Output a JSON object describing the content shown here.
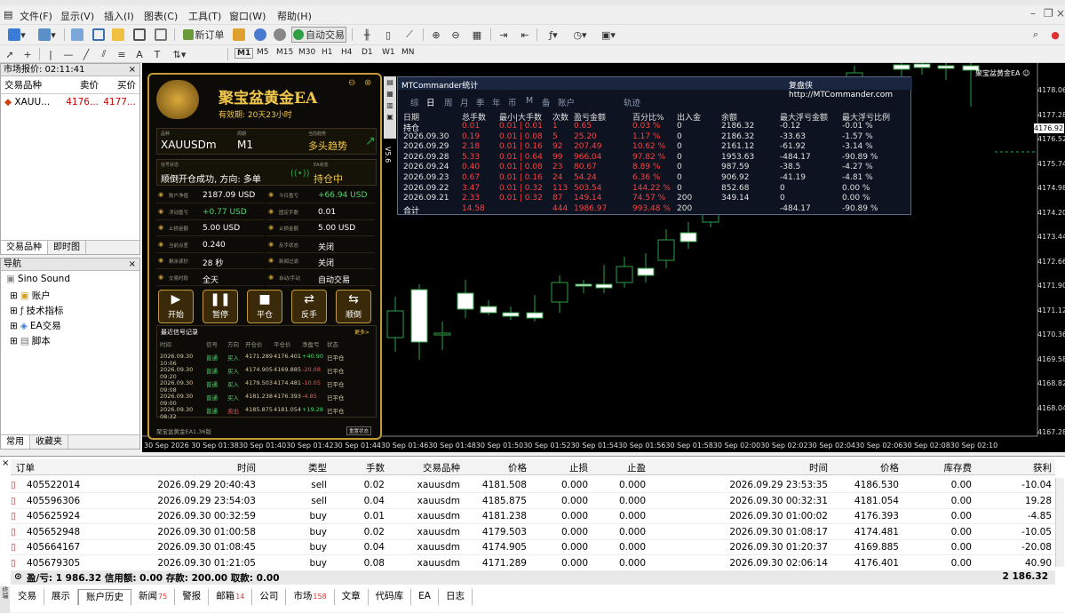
{
  "menu": [
    "文件(F)",
    "显示(V)",
    "插入(I)",
    "图表(C)",
    "工具(T)",
    "窗口(W)",
    "帮助(H)"
  ],
  "toolbar": {
    "new_order": "新订单",
    "auto_trade": "自动交易"
  },
  "timeframes": [
    "M1",
    "M5",
    "M15",
    "M30",
    "H1",
    "H4",
    "D1",
    "W1",
    "MN"
  ],
  "market_watch": {
    "title": "市场报价: 02:11:41",
    "headers": [
      "交易品种",
      "卖价",
      "买价"
    ],
    "row": {
      "symbol": "XAUU...",
      "bid": "4176...",
      "ask": "4177..."
    },
    "tabs": [
      "交易品种",
      "即时图"
    ]
  },
  "navigator": {
    "title": "导航",
    "items": [
      "Sino Sound",
      "账户",
      "技术指标",
      "EA交易",
      "脚本"
    ],
    "tabs": [
      "常用",
      "收藏夹"
    ]
  },
  "chart": {
    "ea_label": "聚宝盆黄金EA ☺",
    "current_price": "4176.923",
    "price_ticks": [
      "4178.060",
      "4177.280",
      "4176.520",
      "4175.740",
      "4174.980",
      "4174.200",
      "4173.440",
      "4172.660",
      "4171.900",
      "4171.120",
      "4170.360",
      "4169.580",
      "4168.820",
      "4168.040",
      "4167.280"
    ],
    "time_ticks": [
      "30 Sep 2026",
      "30 Sep 01:38",
      "30 Sep 01:40",
      "30 Sep 01:42",
      "30 Sep 01:44",
      "30 Sep 01:46",
      "30 Sep 01:48",
      "30 Sep 01:50",
      "30 Sep 01:52",
      "30 Sep 01:54",
      "30 Sep 01:56",
      "30 Sep 01:58",
      "30 Sep 02:00",
      "30 Sep 02:02",
      "30 Sep 02:04",
      "30 Sep 02:06",
      "30 Sep 02:08",
      "30 Sep 02:10"
    ],
    "side_label": "V5.6"
  },
  "ea_panel": {
    "title": "聚宝盆黄金EA",
    "validity": "有效期: 20天23小时",
    "symbol_label": "品种",
    "symbol": "XAUUSDm",
    "period_label": "周期",
    "period": "M1",
    "trend_label": "当前趋势",
    "trend": "多头趋势",
    "signal_label": "信号状态",
    "signal": "顺倒开仓成功, 方向: 多单",
    "ea_status_label": "EA状态",
    "ea_status": "持仓中",
    "stats": [
      {
        "label": "账户净值",
        "value": "2187.09 USD"
      },
      {
        "label": "今日盈亏",
        "value": "+66.94 USD"
      },
      {
        "label": "浮动盈亏",
        "value": "+0.77 USD"
      },
      {
        "label": "固定手数",
        "value": "0.01"
      },
      {
        "label": "止损金额",
        "value": "5.00 USD"
      },
      {
        "label": "止损金额",
        "value": "5.00 USD"
      },
      {
        "label": "当前点差",
        "value": "0.240"
      },
      {
        "label": "反手状态",
        "value": "关闭"
      },
      {
        "label": "剩余读秒",
        "value": "28 秒"
      },
      {
        "label": "新闻过滤",
        "value": "关闭"
      },
      {
        "label": "交易时段",
        "value": "全天"
      },
      {
        "label": "自动/手动",
        "value": "自动交易"
      }
    ],
    "buttons": [
      {
        "label": "开始",
        "sym": "▶"
      },
      {
        "label": "暂停",
        "sym": "❚❚"
      },
      {
        "label": "平仓",
        "sym": "■"
      },
      {
        "label": "反手",
        "sym": "⇄"
      },
      {
        "label": "顺倒",
        "sym": "⇆"
      }
    ],
    "signal_title": "最近信号记录",
    "more": "更多>",
    "signal_headers": [
      "时间",
      "信号",
      "方向",
      "开仓价",
      "平仓价",
      "净盈亏",
      "状态"
    ],
    "signals": [
      [
        "2026.09.30 10:06",
        "普通",
        "买入",
        "4171.289",
        "4176.401",
        "+40.90",
        "已平仓"
      ],
      [
        "2026.09.30 09:20",
        "普通",
        "买入",
        "4174.905",
        "4169.885",
        "-20.08",
        "已平仓"
      ],
      [
        "2026.09.30 09:08",
        "普通",
        "买入",
        "4179.503",
        "4174.481",
        "-10.05",
        "已平仓"
      ],
      [
        "2026.09.30 09:00",
        "普通",
        "买入",
        "4181.238",
        "4176.393",
        "-4.85",
        "已平仓"
      ],
      [
        "2026.09.30 08:32",
        "普通",
        "卖出",
        "4185.875",
        "4181.054",
        "+19.28",
        "已平仓"
      ]
    ],
    "footer": "聚宝盆黄金EA1.36版",
    "footer_btn": "重置状态"
  },
  "stats_panel": {
    "title": "MTCommander统计",
    "link": "复盘侠 http://MTCommander.com",
    "tabs": [
      "综",
      "日",
      "周",
      "月",
      "季",
      "年",
      "币",
      "M",
      "备",
      "账户",
      "轨迹"
    ],
    "headers": [
      "日期",
      "总手数",
      "最小|大手数",
      "次数",
      "盈亏金额",
      "百分比%",
      "出入金",
      "余额",
      "最大浮亏金额",
      "最大浮亏比例"
    ],
    "rows": [
      [
        "持仓",
        "0.01",
        "0.01 | 0.01",
        "1",
        "0.65",
        "0.03 %",
        "0",
        "2186.32",
        "-0.12",
        "-0.01 %"
      ],
      [
        "2026.09.30",
        "0.19",
        "0.01 | 0.08",
        "5",
        "25.20",
        "1.17 %",
        "0",
        "2186.32",
        "-33.63",
        "-1.57 %"
      ],
      [
        "2026.09.29",
        "2.18",
        "0.01 | 0.16",
        "92",
        "207.49",
        "10.62 %",
        "0",
        "2161.12",
        "-61.92",
        "-3.14 %"
      ],
      [
        "2026.09.28",
        "5.33",
        "0.01 | 0.64",
        "99",
        "966.04",
        "97.82 %",
        "0",
        "1953.63",
        "-484.17",
        "-90.89 %"
      ],
      [
        "2026.09.24",
        "0.40",
        "0.01 | 0.08",
        "23",
        "80.67",
        "8.89 %",
        "0",
        "987.59",
        "-38.5",
        "-4.27 %"
      ],
      [
        "2026.09.23",
        "0.67",
        "0.01 | 0.16",
        "24",
        "54.24",
        "6.36 %",
        "0",
        "906.92",
        "-41.19",
        "-4.81 %"
      ],
      [
        "2026.09.22",
        "3.47",
        "0.01 | 0.32",
        "113",
        "503.54",
        "144.22 %",
        "0",
        "852.68",
        "0",
        "0.00 %"
      ],
      [
        "2026.09.21",
        "2.33",
        "0.01 | 0.32",
        "87",
        "149.14",
        "74.57 %",
        "200",
        "349.14",
        "0",
        "0.00 %"
      ],
      [
        "合计",
        "14.58",
        "",
        "444",
        "1986.97",
        "993.48 %",
        "200",
        "",
        "-484.17",
        "-90.89 %"
      ]
    ]
  },
  "terminal": {
    "headers": [
      "订单",
      "时间",
      "类型",
      "手数",
      "交易品种",
      "价格",
      "止损",
      "止盈",
      "时间",
      "价格",
      "库存费",
      "获利"
    ],
    "rows": [
      [
        "405522014",
        "2026.09.29 20:40:43",
        "sell",
        "0.02",
        "xauusdm",
        "4181.508",
        "0.000",
        "0.000",
        "2026.09.29 23:53:35",
        "4186.530",
        "0.00",
        "-10.04"
      ],
      [
        "405596306",
        "2026.09.29 23:54:03",
        "sell",
        "0.04",
        "xauusdm",
        "4185.875",
        "0.000",
        "0.000",
        "2026.09.30 00:32:31",
        "4181.054",
        "0.00",
        "19.28"
      ],
      [
        "405625924",
        "2026.09.30 00:32:59",
        "buy",
        "0.01",
        "xauusdm",
        "4181.238",
        "0.000",
        "0.000",
        "2026.09.30 01:00:02",
        "4176.393",
        "0.00",
        "-4.85"
      ],
      [
        "405652948",
        "2026.09.30 01:00:58",
        "buy",
        "0.02",
        "xauusdm",
        "4179.503",
        "0.000",
        "0.000",
        "2026.09.30 01:08:17",
        "4174.481",
        "0.00",
        "-10.05"
      ],
      [
        "405664167",
        "2026.09.30 01:08:45",
        "buy",
        "0.04",
        "xauusdm",
        "4174.905",
        "0.000",
        "0.000",
        "2026.09.30 01:20:37",
        "4169.885",
        "0.00",
        "-20.08"
      ],
      [
        "405679305",
        "2026.09.30 01:21:05",
        "buy",
        "0.08",
        "xauusdm",
        "4171.289",
        "0.000",
        "0.000",
        "2026.09.30 02:06:14",
        "4176.401",
        "0.00",
        "40.90"
      ]
    ],
    "summary": "盈/亏: 1 986.32  信用额: 0.00  存款: 200.00  取款: 0.00",
    "total": "2 186.32",
    "tabs": [
      {
        "label": "交易",
        "badge": ""
      },
      {
        "label": "展示",
        "badge": ""
      },
      {
        "label": "账户历史",
        "badge": ""
      },
      {
        "label": "新闻",
        "badge": "75"
      },
      {
        "label": "警报",
        "badge": ""
      },
      {
        "label": "邮箱",
        "badge": "14"
      },
      {
        "label": "公司",
        "badge": ""
      },
      {
        "label": "市场",
        "badge": "158"
      },
      {
        "label": "文章",
        "badge": ""
      },
      {
        "label": "代码库",
        "badge": ""
      },
      {
        "label": "EA",
        "badge": ""
      },
      {
        "label": "日志",
        "badge": ""
      }
    ],
    "side_label": "终端"
  }
}
